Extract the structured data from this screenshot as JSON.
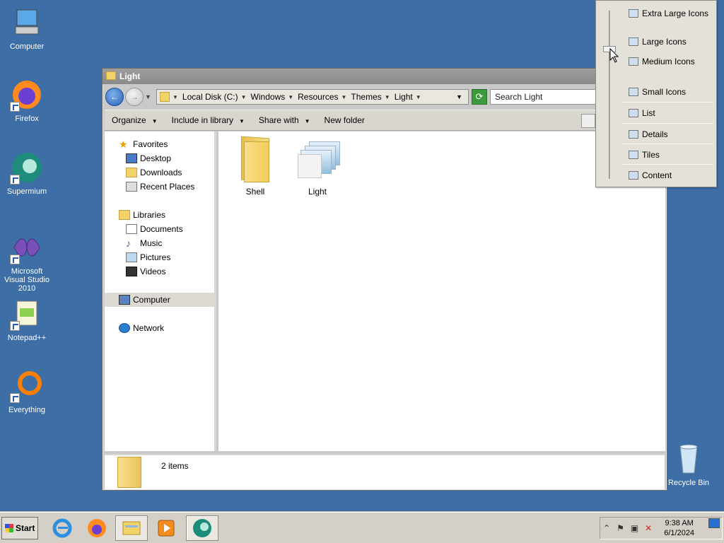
{
  "desktop": {
    "icons": [
      {
        "label": "Computer",
        "icon": "computer-icon"
      },
      {
        "label": "Firefox",
        "icon": "firefox-icon"
      },
      {
        "label": "Supermium",
        "icon": "supermium-icon"
      },
      {
        "label": "Microsoft Visual Studio 2010",
        "icon": "visual-studio-icon"
      },
      {
        "label": "Notepad++",
        "icon": "notepadpp-icon"
      },
      {
        "label": "Everything",
        "icon": "everything-icon"
      },
      {
        "label": "Recycle Bin",
        "icon": "recycle-bin-icon"
      }
    ]
  },
  "window": {
    "title": "Light",
    "breadcrumbs": [
      "Local Disk (C:)",
      "Windows",
      "Resources",
      "Themes",
      "Light"
    ],
    "search_placeholder": "Search Light",
    "toolbar": {
      "organize": "Organize",
      "include": "Include in library",
      "share": "Share with",
      "new_folder": "New folder"
    },
    "nav": {
      "favorites": "Favorites",
      "desktop": "Desktop",
      "downloads": "Downloads",
      "recent": "Recent Places",
      "libraries": "Libraries",
      "documents": "Documents",
      "music": "Music",
      "pictures": "Pictures",
      "videos": "Videos",
      "computer": "Computer",
      "network": "Network"
    },
    "files": [
      {
        "name": "Shell",
        "type": "folder"
      },
      {
        "name": "Light",
        "type": "theme-file"
      }
    ],
    "status": "2 items"
  },
  "view_menu": {
    "items": [
      "Extra Large Icons",
      "Large Icons",
      "Medium Icons",
      "Small Icons",
      "List",
      "Details",
      "Tiles",
      "Content"
    ]
  },
  "taskbar": {
    "start_label": "Start",
    "apps": [
      "internet-explorer-icon",
      "firefox-icon",
      "file-explorer-icon",
      "media-player-icon",
      "supermium-icon"
    ],
    "time": "9:38 AM",
    "date": "6/1/2024"
  }
}
